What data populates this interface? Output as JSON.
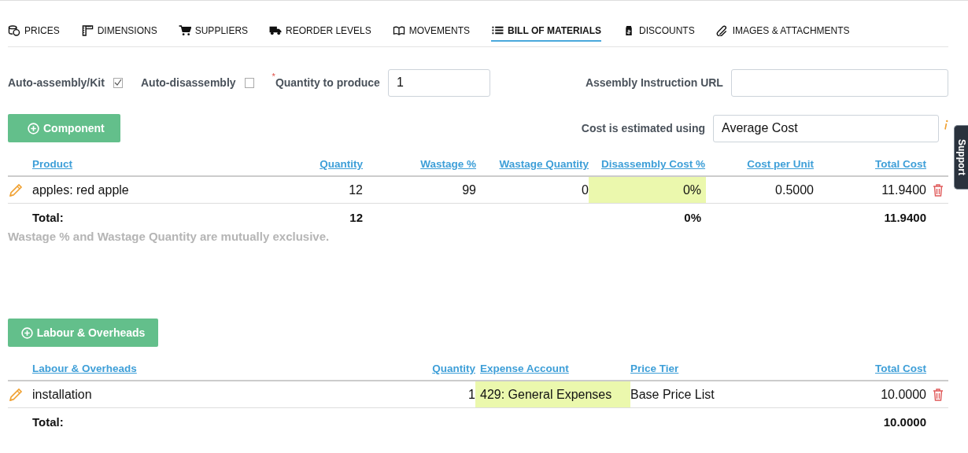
{
  "tabs": [
    {
      "label": "PRICES",
      "selected": false
    },
    {
      "label": "DIMENSIONS",
      "selected": false
    },
    {
      "label": "SUPPLIERS",
      "selected": false
    },
    {
      "label": "REORDER LEVELS",
      "selected": false
    },
    {
      "label": "MOVEMENTS",
      "selected": false
    },
    {
      "label": "BILL OF MATERIALS",
      "selected": true
    },
    {
      "label": "DISCOUNTS",
      "selected": false
    },
    {
      "label": "IMAGES & ATTACHMENTS",
      "selected": false
    }
  ],
  "form": {
    "auto_assembly": {
      "label": "Auto-assembly/Kit",
      "checked": true
    },
    "auto_disassembly": {
      "label": "Auto-disassembly",
      "checked": false
    },
    "quantity_to_produce": {
      "required_mark": "*",
      "label": "Quantity to produce",
      "value": "1"
    },
    "assembly_instruction_url": {
      "label": "Assembly Instruction URL"
    },
    "cost_method": {
      "label": "Cost is estimated using",
      "value": "Average Cost"
    }
  },
  "components": {
    "button": "Component",
    "columns": [
      {
        "label": "Product",
        "kind": "text"
      },
      {
        "label": "Quantity",
        "kind": "number"
      },
      {
        "label": "Wastage %",
        "kind": "number"
      },
      {
        "label": "Wastage Quantity",
        "kind": "number"
      },
      {
        "label": "Disassembly Cost %",
        "kind": "rate"
      },
      {
        "label": "Cost per Unit",
        "kind": "number"
      },
      {
        "label": "Total Cost",
        "kind": "number"
      }
    ],
    "rows": [
      {
        "cells": [
          "apples: red apple",
          "12",
          "99",
          "0",
          "0%",
          "0.5000",
          "11.9400"
        ]
      }
    ],
    "total": {
      "label": "Total:",
      "cells": [
        "12",
        null,
        null,
        "0%",
        null,
        "11.9400"
      ]
    },
    "note": "Wastage % and Wastage Quantity are mutually exclusive."
  },
  "labour": {
    "button": "Labour & Overheads",
    "columns": [
      {
        "label": "Labour & Overheads",
        "kind": "text"
      },
      {
        "label": "Quantity",
        "kind": "number"
      },
      {
        "label": "Expense Account",
        "kind": "account"
      },
      {
        "label": "Price Tier",
        "kind": "text"
      },
      {
        "label": "Total Cost",
        "kind": "number"
      }
    ],
    "rows": [
      {
        "cells": [
          "installation",
          "1",
          "429: General Expenses",
          "Base Price List",
          "10.0000"
        ]
      }
    ],
    "total": {
      "label": "Total:",
      "cells": [
        null,
        null,
        null,
        "10.0000"
      ]
    }
  },
  "support_tab": "Support"
}
